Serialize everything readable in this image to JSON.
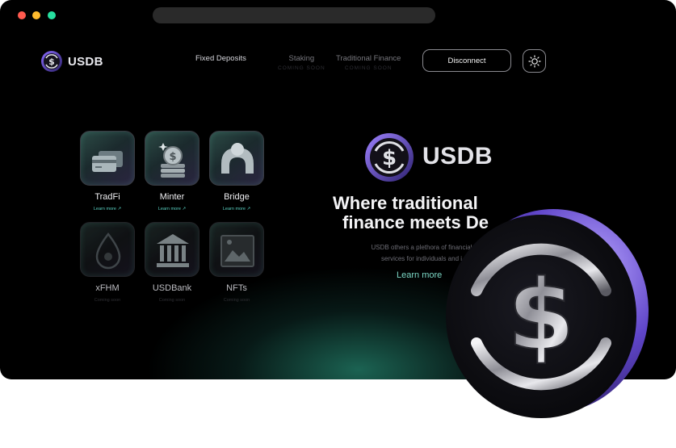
{
  "browser": {
    "traffic_lights": [
      "close",
      "minimize",
      "maximize"
    ]
  },
  "nav": {
    "brand": "USDB",
    "links": [
      {
        "label": "Fixed Deposits",
        "sub": ""
      },
      {
        "label": "Staking",
        "sub": "COMING SOON"
      },
      {
        "label": "Traditional Finance",
        "sub": "COMING SOON"
      }
    ],
    "disconnect_label": "Disconnect",
    "theme_icon": "sun-icon"
  },
  "tiles": [
    {
      "label": "TradFi",
      "sub": "Learn more ↗",
      "icon": "credit-cards-icon",
      "active": true
    },
    {
      "label": "Minter",
      "sub": "Learn more ↗",
      "icon": "coin-stack-icon",
      "active": true
    },
    {
      "label": "Bridge",
      "sub": "Learn more ↗",
      "icon": "bridge-arch-icon",
      "active": true
    },
    {
      "label": "xFHM",
      "sub": "Coming soon",
      "icon": "drop-icon",
      "active": false
    },
    {
      "label": "USDBank",
      "sub": "Coming soon",
      "icon": "bank-icon",
      "active": false
    },
    {
      "label": "NFTs",
      "sub": "Coming soon",
      "icon": "image-frame-icon",
      "active": false
    }
  ],
  "hero": {
    "brand": "USDB",
    "title_line1": "Where traditional",
    "title_line2": "finance meets De",
    "desc_line1": "USDB others a plethora of financial",
    "desc_line2": "services for individuals and i",
    "learn_more": "Learn more"
  },
  "colors": {
    "accent": "#5ad1c2",
    "background": "#000000",
    "coin_rim": "#6a4fd8"
  }
}
